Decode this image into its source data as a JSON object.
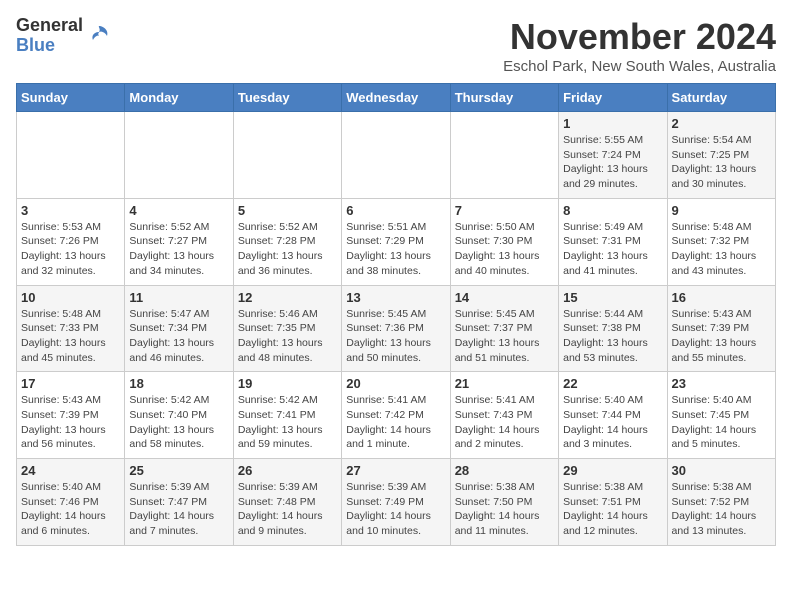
{
  "logo": {
    "general": "General",
    "blue": "Blue"
  },
  "header": {
    "month_title": "November 2024",
    "location": "Eschol Park, New South Wales, Australia"
  },
  "days_of_week": [
    "Sunday",
    "Monday",
    "Tuesday",
    "Wednesday",
    "Thursday",
    "Friday",
    "Saturday"
  ],
  "weeks": [
    [
      {
        "day": "",
        "info": ""
      },
      {
        "day": "",
        "info": ""
      },
      {
        "day": "",
        "info": ""
      },
      {
        "day": "",
        "info": ""
      },
      {
        "day": "",
        "info": ""
      },
      {
        "day": "1",
        "info": "Sunrise: 5:55 AM\nSunset: 7:24 PM\nDaylight: 13 hours\nand 29 minutes."
      },
      {
        "day": "2",
        "info": "Sunrise: 5:54 AM\nSunset: 7:25 PM\nDaylight: 13 hours\nand 30 minutes."
      }
    ],
    [
      {
        "day": "3",
        "info": "Sunrise: 5:53 AM\nSunset: 7:26 PM\nDaylight: 13 hours\nand 32 minutes."
      },
      {
        "day": "4",
        "info": "Sunrise: 5:52 AM\nSunset: 7:27 PM\nDaylight: 13 hours\nand 34 minutes."
      },
      {
        "day": "5",
        "info": "Sunrise: 5:52 AM\nSunset: 7:28 PM\nDaylight: 13 hours\nand 36 minutes."
      },
      {
        "day": "6",
        "info": "Sunrise: 5:51 AM\nSunset: 7:29 PM\nDaylight: 13 hours\nand 38 minutes."
      },
      {
        "day": "7",
        "info": "Sunrise: 5:50 AM\nSunset: 7:30 PM\nDaylight: 13 hours\nand 40 minutes."
      },
      {
        "day": "8",
        "info": "Sunrise: 5:49 AM\nSunset: 7:31 PM\nDaylight: 13 hours\nand 41 minutes."
      },
      {
        "day": "9",
        "info": "Sunrise: 5:48 AM\nSunset: 7:32 PM\nDaylight: 13 hours\nand 43 minutes."
      }
    ],
    [
      {
        "day": "10",
        "info": "Sunrise: 5:48 AM\nSunset: 7:33 PM\nDaylight: 13 hours\nand 45 minutes."
      },
      {
        "day": "11",
        "info": "Sunrise: 5:47 AM\nSunset: 7:34 PM\nDaylight: 13 hours\nand 46 minutes."
      },
      {
        "day": "12",
        "info": "Sunrise: 5:46 AM\nSunset: 7:35 PM\nDaylight: 13 hours\nand 48 minutes."
      },
      {
        "day": "13",
        "info": "Sunrise: 5:45 AM\nSunset: 7:36 PM\nDaylight: 13 hours\nand 50 minutes."
      },
      {
        "day": "14",
        "info": "Sunrise: 5:45 AM\nSunset: 7:37 PM\nDaylight: 13 hours\nand 51 minutes."
      },
      {
        "day": "15",
        "info": "Sunrise: 5:44 AM\nSunset: 7:38 PM\nDaylight: 13 hours\nand 53 minutes."
      },
      {
        "day": "16",
        "info": "Sunrise: 5:43 AM\nSunset: 7:39 PM\nDaylight: 13 hours\nand 55 minutes."
      }
    ],
    [
      {
        "day": "17",
        "info": "Sunrise: 5:43 AM\nSunset: 7:39 PM\nDaylight: 13 hours\nand 56 minutes."
      },
      {
        "day": "18",
        "info": "Sunrise: 5:42 AM\nSunset: 7:40 PM\nDaylight: 13 hours\nand 58 minutes."
      },
      {
        "day": "19",
        "info": "Sunrise: 5:42 AM\nSunset: 7:41 PM\nDaylight: 13 hours\nand 59 minutes."
      },
      {
        "day": "20",
        "info": "Sunrise: 5:41 AM\nSunset: 7:42 PM\nDaylight: 14 hours\nand 1 minute."
      },
      {
        "day": "21",
        "info": "Sunrise: 5:41 AM\nSunset: 7:43 PM\nDaylight: 14 hours\nand 2 minutes."
      },
      {
        "day": "22",
        "info": "Sunrise: 5:40 AM\nSunset: 7:44 PM\nDaylight: 14 hours\nand 3 minutes."
      },
      {
        "day": "23",
        "info": "Sunrise: 5:40 AM\nSunset: 7:45 PM\nDaylight: 14 hours\nand 5 minutes."
      }
    ],
    [
      {
        "day": "24",
        "info": "Sunrise: 5:40 AM\nSunset: 7:46 PM\nDaylight: 14 hours\nand 6 minutes."
      },
      {
        "day": "25",
        "info": "Sunrise: 5:39 AM\nSunset: 7:47 PM\nDaylight: 14 hours\nand 7 minutes."
      },
      {
        "day": "26",
        "info": "Sunrise: 5:39 AM\nSunset: 7:48 PM\nDaylight: 14 hours\nand 9 minutes."
      },
      {
        "day": "27",
        "info": "Sunrise: 5:39 AM\nSunset: 7:49 PM\nDaylight: 14 hours\nand 10 minutes."
      },
      {
        "day": "28",
        "info": "Sunrise: 5:38 AM\nSunset: 7:50 PM\nDaylight: 14 hours\nand 11 minutes."
      },
      {
        "day": "29",
        "info": "Sunrise: 5:38 AM\nSunset: 7:51 PM\nDaylight: 14 hours\nand 12 minutes."
      },
      {
        "day": "30",
        "info": "Sunrise: 5:38 AM\nSunset: 7:52 PM\nDaylight: 14 hours\nand 13 minutes."
      }
    ]
  ]
}
